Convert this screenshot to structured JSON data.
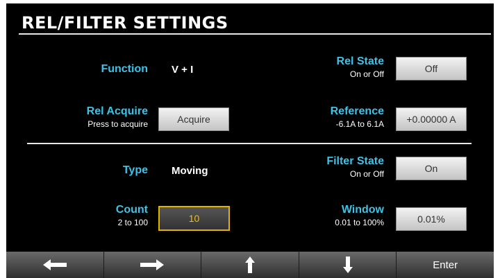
{
  "title": "REL/FILTER SETTINGS",
  "rel": {
    "function": {
      "label": "Function",
      "value": "V + I"
    },
    "rel_state": {
      "label": "Rel State",
      "hint": "On or Off",
      "value": "Off"
    },
    "rel_acquire": {
      "label": "Rel Acquire",
      "hint": "Press to acquire",
      "button": "Acquire"
    },
    "reference": {
      "label": "Reference",
      "hint": "-6.1A to 6.1A",
      "value": "+0.00000 A"
    }
  },
  "filter": {
    "type": {
      "label": "Type",
      "value": "Moving"
    },
    "filter_state": {
      "label": "Filter State",
      "hint": "On or Off",
      "value": "On"
    },
    "count": {
      "label": "Count",
      "hint": "2 to 100",
      "value": "10"
    },
    "window": {
      "label": "Window",
      "hint": "0.01 to 100%",
      "value": "0.01%"
    }
  },
  "softkeys": {
    "left": "left-arrow-icon",
    "right": "right-arrow-icon",
    "up": "up-arrow-icon",
    "down": "down-arrow-icon",
    "enter": "Enter"
  },
  "colors": {
    "label_accent": "#3ec3e8",
    "active_field_border": "#e2b400",
    "active_field_text": "#f3c000"
  }
}
